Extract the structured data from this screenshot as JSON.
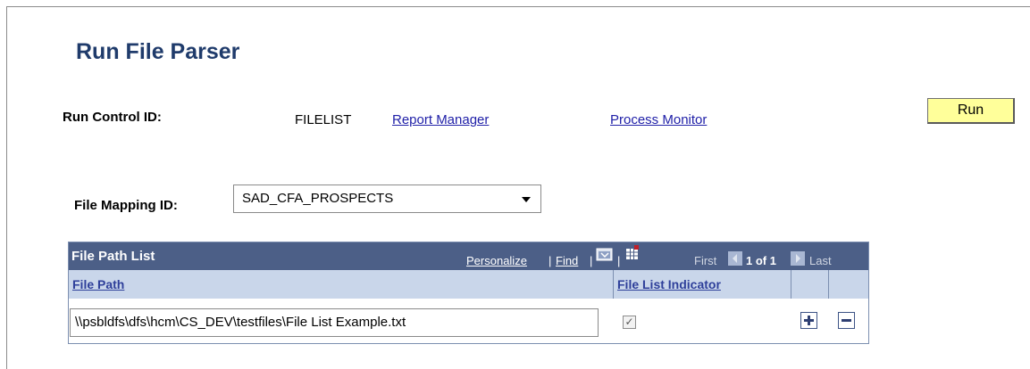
{
  "page": {
    "title": "Run File Parser"
  },
  "run_control": {
    "label": "Run Control ID:",
    "value": "FILELIST",
    "report_manager_link": "Report Manager",
    "process_monitor_link": "Process Monitor",
    "run_button": "Run"
  },
  "file_mapping": {
    "label": "File Mapping ID:",
    "selected": "SAD_CFA_PROSPECTS"
  },
  "grid": {
    "title": "File Path List",
    "personalize": "Personalize",
    "separator": "|",
    "find": "Find",
    "first": "First",
    "count": "1 of 1",
    "last": "Last",
    "columns": [
      "File Path",
      "File List Indicator"
    ],
    "rows": [
      {
        "file_path": "\\\\psbldfs\\dfs\\hcm\\CS_DEV\\testfiles\\File List Example.txt",
        "file_list_indicator": "✓"
      }
    ]
  },
  "colors": {
    "title": "#1f3b6b",
    "link": "#2020a8",
    "grid_header": "#4c5f87",
    "column_header": "#c9d6ea",
    "run_button": "#ffff9a"
  },
  "icons": [
    "view-all-icon",
    "download-icon",
    "previous-icon",
    "next-icon",
    "add-row-icon",
    "delete-row-icon"
  ]
}
